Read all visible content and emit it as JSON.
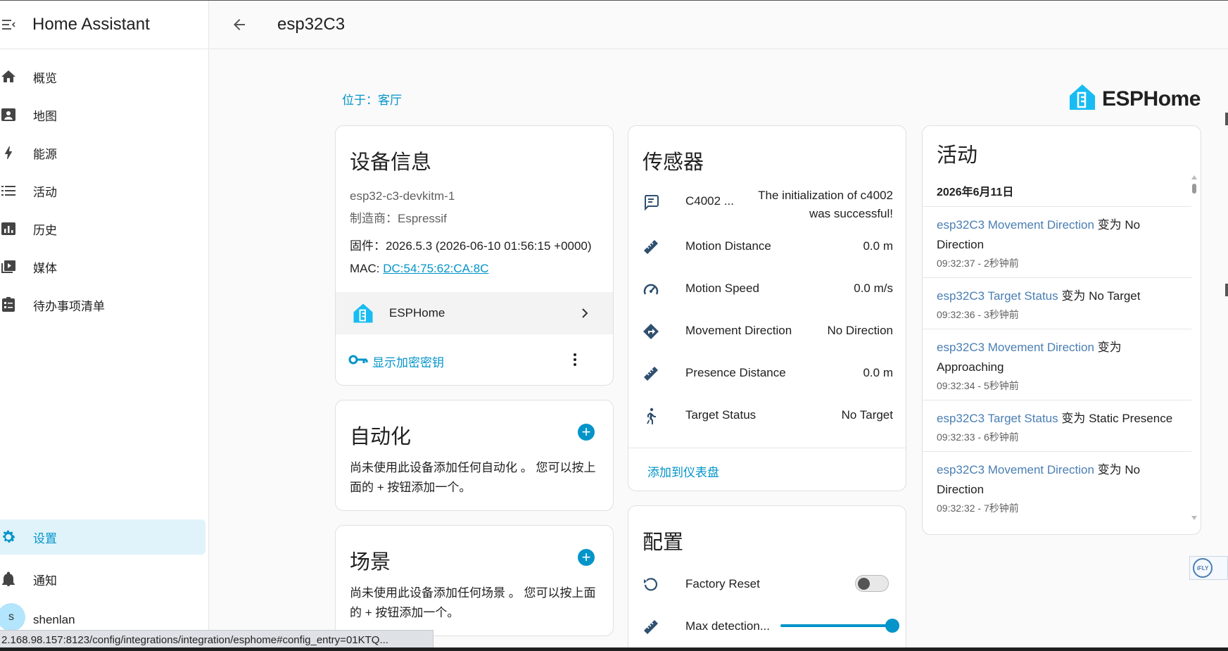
{
  "app": {
    "title": "Home Assistant"
  },
  "sidebar": {
    "items": [
      {
        "label": "概览",
        "icon": "home-icon"
      },
      {
        "label": "地图",
        "icon": "map-icon"
      },
      {
        "label": "能源",
        "icon": "energy-icon"
      },
      {
        "label": "活动",
        "icon": "activity-icon"
      },
      {
        "label": "历史",
        "icon": "history-icon"
      },
      {
        "label": "媒体",
        "icon": "media-icon"
      },
      {
        "label": "待办事项清单",
        "icon": "todo-icon"
      }
    ],
    "bottom_items": [
      {
        "label": "设置",
        "icon": "gear-icon",
        "active": true
      },
      {
        "label": "通知",
        "icon": "bell-icon"
      }
    ],
    "user": {
      "initial": "s",
      "name": "shenlan"
    }
  },
  "header": {
    "title": "esp32C3"
  },
  "device": {
    "location": "位于：客厅",
    "brand": "ESPHome",
    "info": {
      "title": "设备信息",
      "model": "esp32-c3-devkitm-1",
      "manufacturer": "制造商：Espressif",
      "firmware": "固件：2026.5.3 (2026-06-10 01:56:15 +0000)",
      "mac_label": "MAC: ",
      "mac": "DC:54:75:62:CA:8C",
      "integration": "ESPHome",
      "show_key": "显示加密密钥"
    }
  },
  "automation": {
    "title": "自动化",
    "desc": "尚未使用此设备添加任何自动化 。 您可以按上面的 + 按钮添加一个。"
  },
  "scene": {
    "title": "场景",
    "desc": "尚未使用此设备添加任何场景 。 您可以按上面的 + 按钮添加一个。"
  },
  "sensors": {
    "title": "传感器",
    "rows": [
      {
        "name": "C4002 ...",
        "value": "The initialization of c4002 was successful!",
        "icon": "message-icon"
      },
      {
        "name": "Motion Distance",
        "value": "0.0 m",
        "icon": "ruler-icon"
      },
      {
        "name": "Motion Speed",
        "value": "0.0 m/s",
        "icon": "speedometer-icon"
      },
      {
        "name": "Movement Direction",
        "value": "No Direction",
        "icon": "direction-icon"
      },
      {
        "name": "Presence Distance",
        "value": "0.0 m",
        "icon": "ruler-icon"
      },
      {
        "name": "Target Status",
        "value": "No Target",
        "icon": "person-icon"
      }
    ],
    "add_to_dashboard": "添加到仪表盘"
  },
  "config": {
    "title": "配置",
    "rows": [
      {
        "name": "Factory Reset",
        "icon": "restore-icon"
      },
      {
        "name": "Max detection...",
        "icon": "ruler-icon"
      }
    ]
  },
  "activity": {
    "title": "活动",
    "date": "2026年6月11日",
    "items": [
      {
        "entity": "esp32C3 Movement Direction",
        "change": " 变为 No Direction",
        "time": "09:32:37 - 2秒钟前"
      },
      {
        "entity": "esp32C3 Target Status",
        "change": " 变为 No Target",
        "time": "09:32:36 - 3秒钟前"
      },
      {
        "entity": "esp32C3 Movement Direction",
        "change": " 变为 Approaching",
        "time": "09:32:34 - 5秒钟前"
      },
      {
        "entity": "esp32C3 Target Status",
        "change": " 变为 Static Presence",
        "time": "09:32:33 - 6秒钟前"
      },
      {
        "entity": "esp32C3 Movement Direction",
        "change": " 变为 No Direction",
        "time": "09:32:32 - 7秒钟前"
      }
    ]
  },
  "status_url": "2.168.98.157:8123/config/integrations/integration/esphome#config_entry=01KTQ...",
  "ifly": "iFLY",
  "colors": {
    "accent": "#0394c9",
    "entity_link": "#4a7eb3",
    "active_bg": "#e0f3fa"
  }
}
